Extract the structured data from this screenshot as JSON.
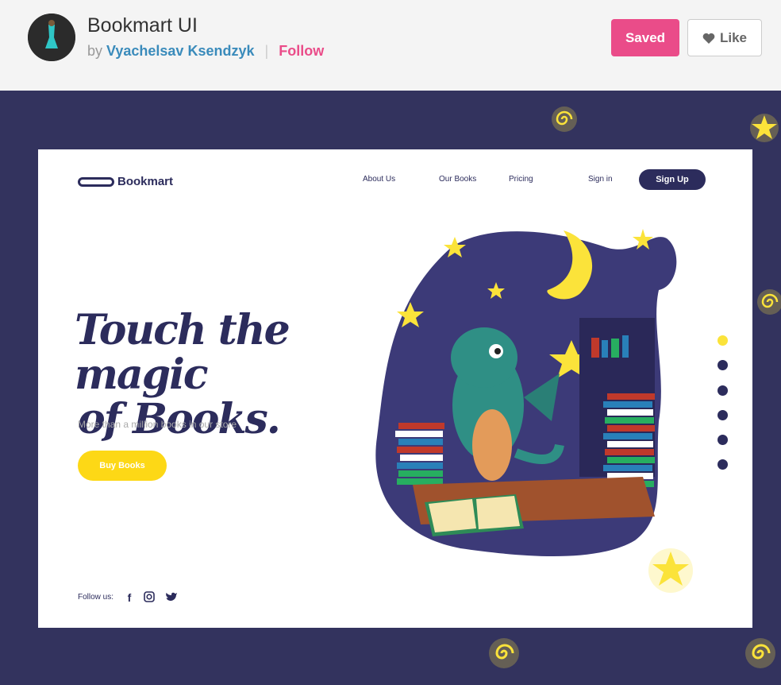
{
  "shot": {
    "title": "Bookmart UI",
    "by_prefix": "by",
    "author": "Vyachelsav Ksendzyk",
    "separator": "|",
    "follow_label": "Follow",
    "saved_label": "Saved",
    "like_label": "Like"
  },
  "site": {
    "logo_text": "Bookmart",
    "nav": {
      "about": "About Us",
      "books": "Our Books",
      "pricing": "Pricing",
      "signin": "Sign in",
      "signup": "Sign Up"
    },
    "hero_line1": "Touch the magic",
    "hero_line2": "of Books.",
    "subtitle": "More than a million books in our store",
    "buy_label": "Buy Books",
    "follow_us": "Follow us:",
    "social_icons": [
      "facebook-icon",
      "instagram-icon",
      "twitter-icon"
    ],
    "pager_dots": 6,
    "active_dot": 1
  },
  "colors": {
    "brand_pink": "#ea4c89",
    "author_blue": "#3a8bbb",
    "navy": "#2c2c5c",
    "shot_bg": "#33335e",
    "yellow": "#fdd816"
  }
}
